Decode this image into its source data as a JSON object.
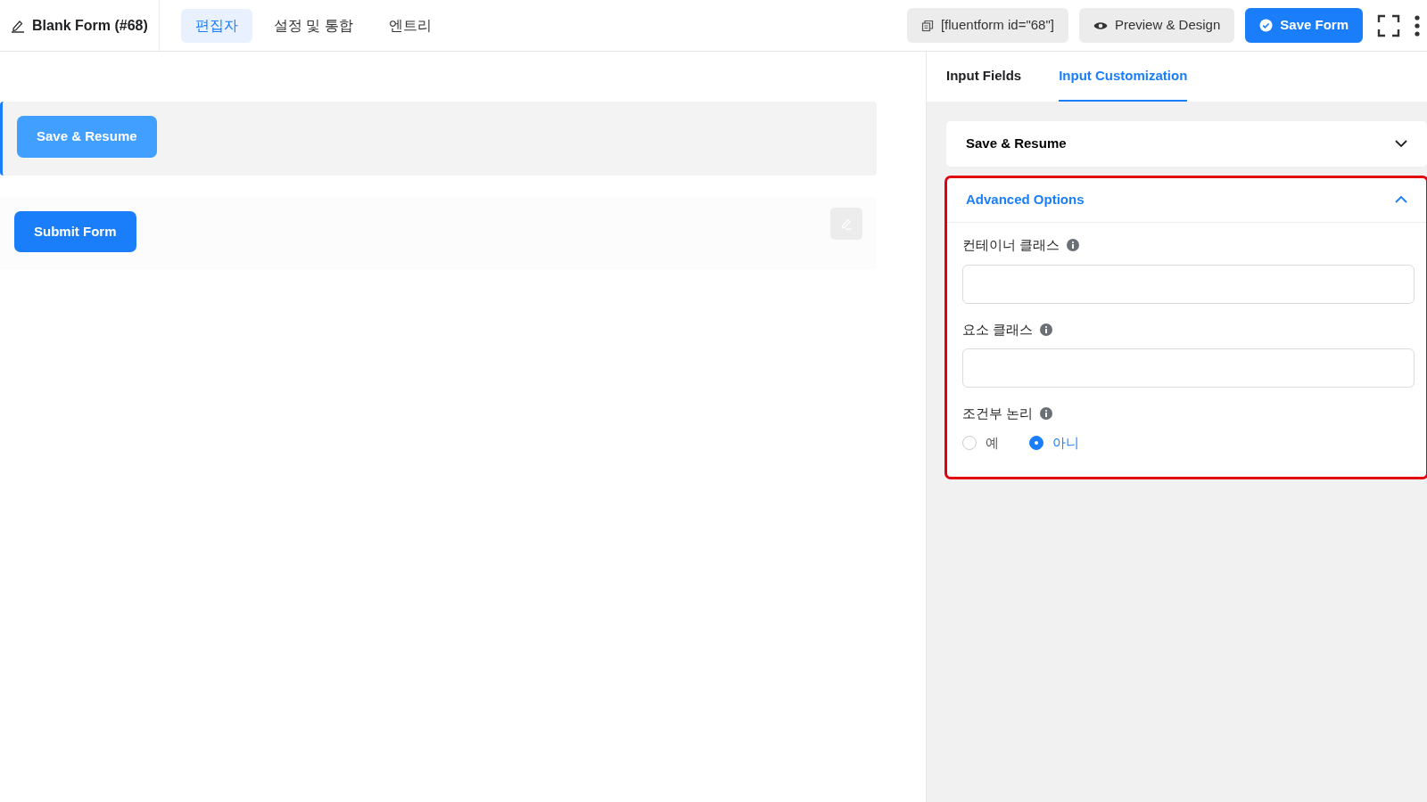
{
  "header": {
    "title": "Blank Form (#68)",
    "tabs": [
      {
        "label": "편집자",
        "selected": true
      },
      {
        "label": "설정 및 통합",
        "selected": false
      },
      {
        "label": "엔트리",
        "selected": false
      }
    ],
    "shortcode": "[fluentform id=\"68\"]",
    "preview_button": "Preview & Design",
    "save_button": "Save Form"
  },
  "canvas": {
    "fields": [
      {
        "kind": "save_resume",
        "label": "Save & Resume",
        "selected": true
      },
      {
        "kind": "submit",
        "label": "Submit Form",
        "selected": false
      }
    ]
  },
  "panel": {
    "tabs": [
      {
        "label": "Input Fields",
        "selected": false
      },
      {
        "label": "Input Customization",
        "selected": true
      }
    ],
    "sections": [
      {
        "title": "Save & Resume",
        "expanded": false,
        "highlighted": false
      },
      {
        "title": "Advanced Options",
        "expanded": true,
        "highlighted": true,
        "options": [
          {
            "kind": "text",
            "label": "컨테이너 클래스"
          },
          {
            "kind": "text",
            "label": "요소 클래스"
          },
          {
            "kind": "radio",
            "label": "조건부 논리",
            "choices": [
              {
                "label": "예",
                "selected": false
              },
              {
                "label": "아니",
                "selected": true
              }
            ]
          }
        ]
      }
    ]
  }
}
